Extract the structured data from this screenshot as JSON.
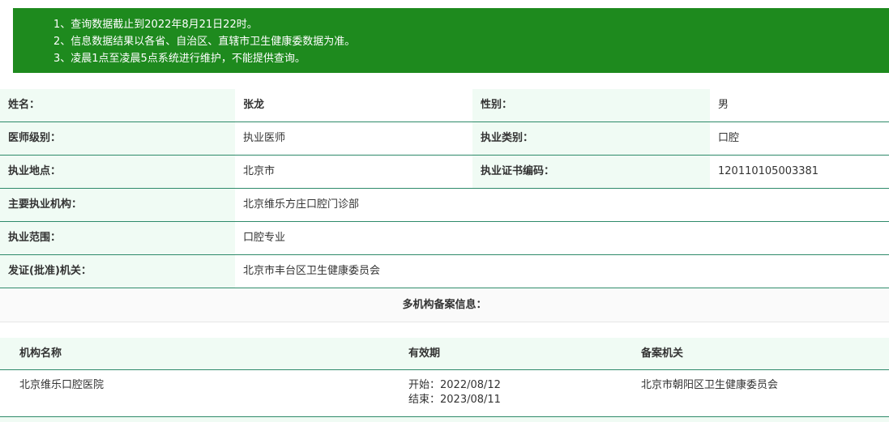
{
  "notice": {
    "lines": [
      "1、查询数据截止到2022年8月21日22时。",
      "2、信息数据结果以各省、自治区、直辖市卫生健康委数据为准。",
      "3、凌晨1点至凌晨5点系统进行维护，不能提供查询。"
    ]
  },
  "info": {
    "name_label": "姓名：",
    "name_value": "张龙",
    "gender_label": "性别：",
    "gender_value": "男",
    "level_label": "医师级别：",
    "level_value": "执业医师",
    "category_label": "执业类别：",
    "category_value": "口腔",
    "location_label": "执业地点：",
    "location_value": "北京市",
    "cert_label": "执业证书编码：",
    "cert_value": "120110105003381",
    "org_label": "主要执业机构：",
    "org_value": "北京维乐方庄口腔门诊部",
    "scope_label": "执业范围：",
    "scope_value": "口腔专业",
    "issuer_label": "发证(批准)机关：",
    "issuer_value": "北京市丰台区卫生健康委员会"
  },
  "multi": {
    "title": "多机构备案信息：",
    "headers": [
      "机构名称",
      "有效期",
      "备案机关"
    ],
    "rows": [
      {
        "name": "北京维乐口腔医院",
        "start": "开始：2022/08/12",
        "end": "结束：2023/08/11",
        "authority": "北京市朝阳区卫生健康委员会"
      }
    ]
  }
}
